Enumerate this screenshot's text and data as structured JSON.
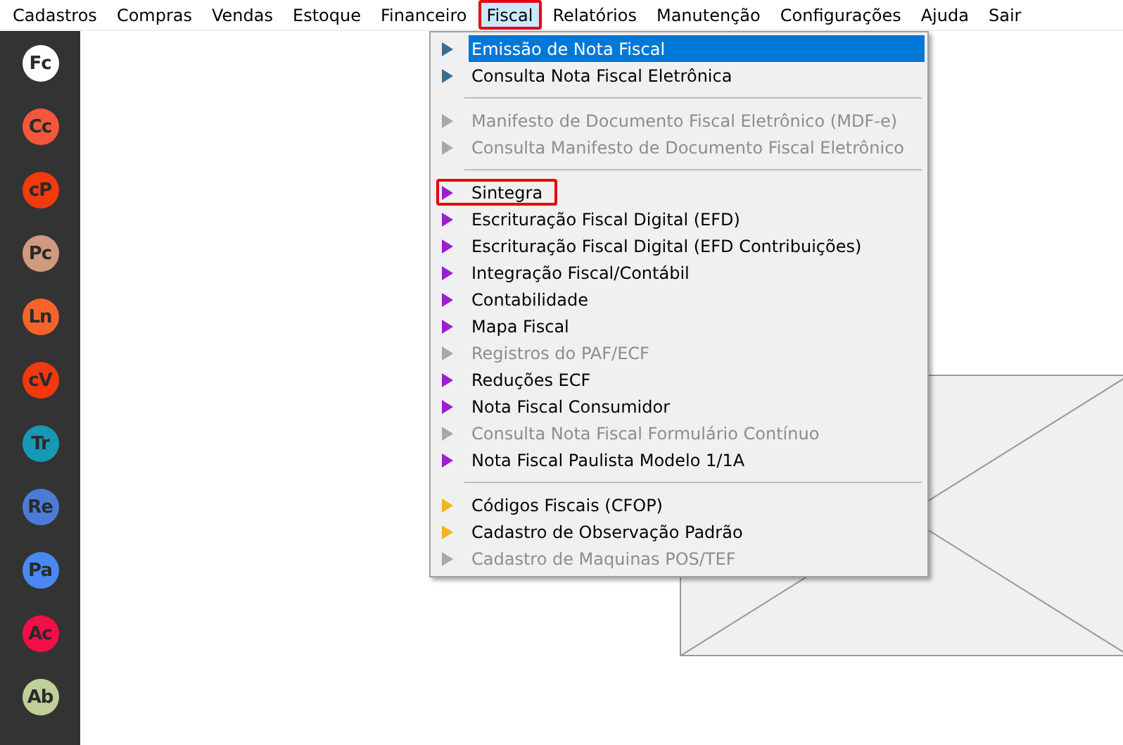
{
  "menu_bar": [
    {
      "label": "Cadastros",
      "selected": false,
      "outlined": false
    },
    {
      "label": "Compras",
      "selected": false,
      "outlined": false
    },
    {
      "label": "Vendas",
      "selected": false,
      "outlined": false
    },
    {
      "label": "Estoque",
      "selected": false,
      "outlined": false
    },
    {
      "label": "Financeiro",
      "selected": false,
      "outlined": false
    },
    {
      "label": "Fiscal",
      "selected": true,
      "outlined": true
    },
    {
      "label": "Relatórios",
      "selected": false,
      "outlined": false
    },
    {
      "label": "Manutenção",
      "selected": false,
      "outlined": false
    },
    {
      "label": "Configurações",
      "selected": false,
      "outlined": false
    },
    {
      "label": "Ajuda",
      "selected": false,
      "outlined": false
    },
    {
      "label": "Sair",
      "selected": false,
      "outlined": false
    }
  ],
  "sidebar": {
    "items": [
      {
        "label": "Fc",
        "color": "#ffffff"
      },
      {
        "label": "Cc",
        "color": "#f4573a"
      },
      {
        "label": "cP",
        "color": "#f23a0c"
      },
      {
        "label": "Pc",
        "color": "#cf9a80"
      },
      {
        "label": "Ln",
        "color": "#f5632b"
      },
      {
        "label": "cV",
        "color": "#f2380e"
      },
      {
        "label": "Tr",
        "color": "#1599b5"
      },
      {
        "label": "Re",
        "color": "#4a7bd6"
      },
      {
        "label": "Pa",
        "color": "#4a88f2"
      },
      {
        "label": "Ac",
        "color": "#f20f49"
      },
      {
        "label": "Ab",
        "color": "#c0cf98"
      }
    ]
  },
  "dropdown": {
    "groups": [
      [
        {
          "label": "Emissão de Nota Fiscal",
          "color": "#3d6b8e",
          "disabled": false,
          "selected": true,
          "outlined": false
        },
        {
          "label": "Consulta Nota Fiscal Eletrônica",
          "color": "#3d6b8e",
          "disabled": false,
          "selected": false,
          "outlined": false
        }
      ],
      [
        {
          "label": "Manifesto de Documento Fiscal Eletrônico (MDF-e)",
          "disabled": true,
          "selected": false,
          "outlined": false
        },
        {
          "label": "Consulta Manifesto de Documento Fiscal Eletrônico",
          "disabled": true,
          "selected": false,
          "outlined": false
        }
      ],
      [
        {
          "label": "Sintegra",
          "color": "#9a1fd3",
          "disabled": false,
          "selected": false,
          "outlined": true
        },
        {
          "label": "Escrituração Fiscal Digital (EFD)",
          "color": "#9a1fd3",
          "disabled": false,
          "selected": false,
          "outlined": false
        },
        {
          "label": "Escrituração Fiscal Digital (EFD Contribuições)",
          "color": "#9a1fd3",
          "disabled": false,
          "selected": false,
          "outlined": false
        },
        {
          "label": "Integração Fiscal/Contábil",
          "color": "#9a1fd3",
          "disabled": false,
          "selected": false,
          "outlined": false
        },
        {
          "label": "Contabilidade",
          "color": "#9a1fd3",
          "disabled": false,
          "selected": false,
          "outlined": false
        },
        {
          "label": "Mapa Fiscal",
          "color": "#9a1fd3",
          "disabled": false,
          "selected": false,
          "outlined": false
        },
        {
          "label": "Registros do PAF/ECF",
          "disabled": true,
          "selected": false,
          "outlined": false
        },
        {
          "label": "Reduções ECF",
          "color": "#9a1fd3",
          "disabled": false,
          "selected": false,
          "outlined": false
        },
        {
          "label": "Nota Fiscal Consumidor",
          "color": "#9a1fd3",
          "disabled": false,
          "selected": false,
          "outlined": false
        },
        {
          "label": "Consulta Nota Fiscal Formulário Contínuo",
          "disabled": true,
          "selected": false,
          "outlined": false
        },
        {
          "label": "Nota Fiscal Paulista Modelo 1/1A",
          "color": "#9a1fd3",
          "disabled": false,
          "selected": false,
          "outlined": false
        }
      ],
      [
        {
          "label": "Códigos Fiscais (CFOP)",
          "color": "#f0b51c",
          "disabled": false,
          "selected": false,
          "outlined": false
        },
        {
          "label": "Cadastro de Observação Padrão",
          "color": "#f0b51c",
          "disabled": false,
          "selected": false,
          "outlined": false
        },
        {
          "label": "Cadastro de Maquinas POS/TEF",
          "disabled": true,
          "selected": false,
          "outlined": false
        }
      ]
    ]
  }
}
